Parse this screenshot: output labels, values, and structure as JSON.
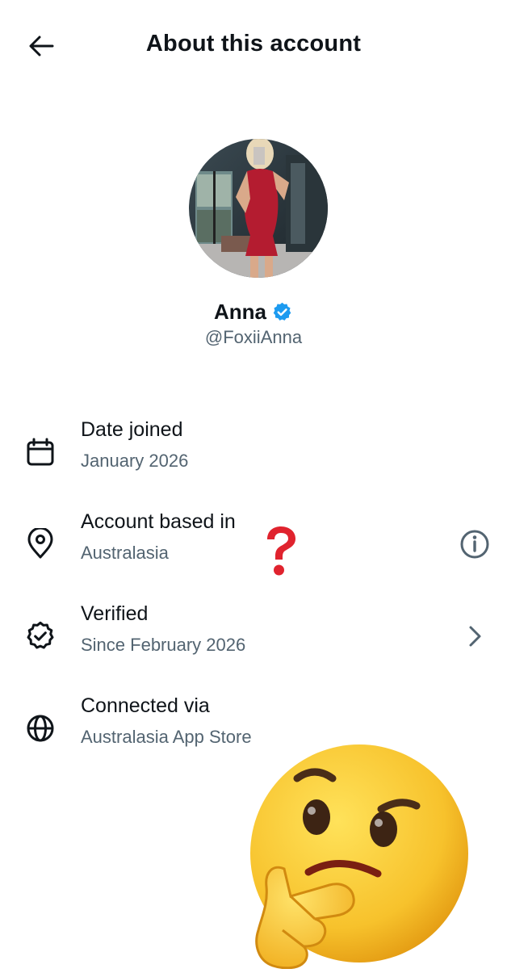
{
  "header": {
    "title": "About this account",
    "back_icon": "arrow-left-icon"
  },
  "profile": {
    "avatar_icon": "profile-photo",
    "name": "Anna",
    "verified_icon": "verified-badge-icon",
    "verified_color": "#1d9bf0",
    "handle": "@FoxiiAnna"
  },
  "details": [
    {
      "icon": "calendar-icon",
      "label": "Date joined",
      "value": "January 2026"
    },
    {
      "icon": "location-pin-icon",
      "label": "Account based in",
      "value": "Australasia",
      "action_icon": "info-icon"
    },
    {
      "icon": "verified-check-icon",
      "label": "Verified",
      "value": "Since February 2026",
      "action_icon": "chevron-right-icon"
    },
    {
      "icon": "globe-icon",
      "label": "Connected via",
      "value": "Australasia App Store"
    }
  ],
  "overlays": {
    "question_mark_icon": "red-question-mark",
    "question_mark_color": "#e0232e",
    "thinking_face_icon": "thinking-face-emoji",
    "emoji_color": "#f7c22c"
  },
  "colors": {
    "text_primary": "#0f1419",
    "text_secondary": "#536471",
    "background": "#ffffff"
  }
}
